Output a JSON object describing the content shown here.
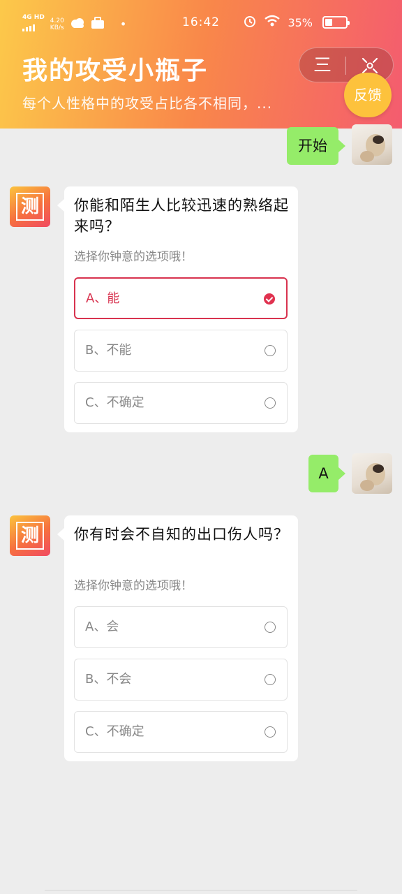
{
  "status_bar": {
    "network": "4G HD",
    "speed": "4.20",
    "speed_unit": "KB/s",
    "time": "16:42",
    "battery": "35%"
  },
  "header": {
    "title": "我的攻受小瓶子",
    "subtitle": "每个人性格中的攻受占比各不相同，...",
    "menu_glyph": "三",
    "feedback_label": "反馈"
  },
  "bot": {
    "avatar_char": "测"
  },
  "chat": {
    "start_message": "开始",
    "questions": [
      {
        "question": "你能和陌生人比较迅速的熟络起来吗？",
        "hint": "选择你钟意的选项哦！",
        "options": [
          "A、能",
          "B、不能",
          "C、不确定"
        ],
        "selected_index": 0
      },
      {
        "question": "你有时会不自知的出口伤人吗？",
        "hint": "选择你钟意的选项哦！",
        "options": [
          "A、会",
          "B、不会",
          "C、不确定"
        ],
        "selected_index": null
      }
    ],
    "answers": [
      "A"
    ]
  },
  "colors": {
    "header_gradient_start": "#fcc94a",
    "header_gradient_end": "#f45c6f",
    "user_bubble": "#95ec69",
    "selected_accent": "#d8334f",
    "feedback_button": "#fdc23c"
  }
}
